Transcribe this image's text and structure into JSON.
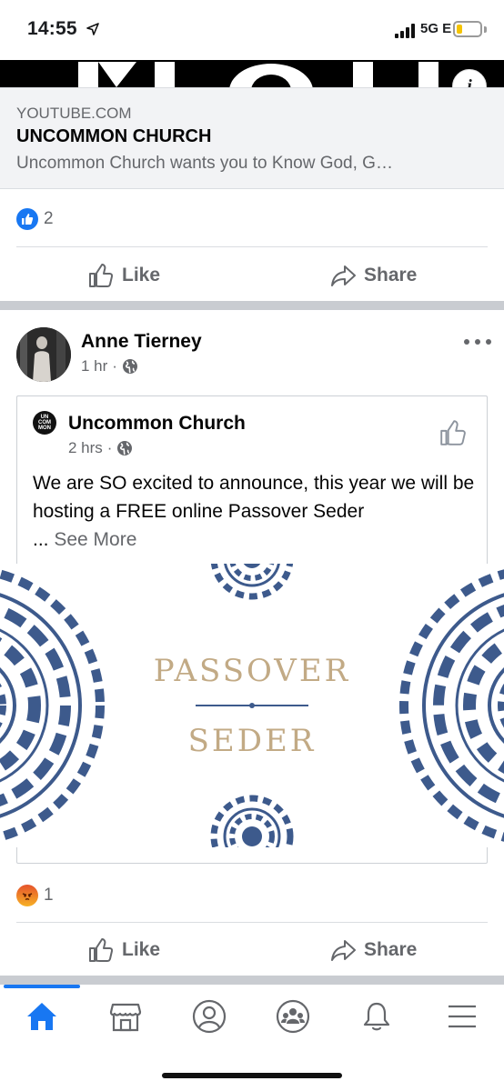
{
  "status_bar": {
    "time": "14:55",
    "network": "5G E",
    "icons": [
      "location-arrow-icon",
      "signal-icon",
      "battery-icon"
    ]
  },
  "link_preview": {
    "domain": "YOUTUBE.COM",
    "title": "UNCOMMON CHURCH",
    "description": "Uncommon Church wants you to Know God, G…",
    "banner_letters": "MON"
  },
  "post1": {
    "reaction_count": "2",
    "like_label": "Like",
    "share_label": "Share"
  },
  "post2": {
    "author": "Anne Tierney",
    "time": "1 hr",
    "dot": "·",
    "shared": {
      "page_name": "Uncommon Church",
      "page_logo_lines": [
        "UN",
        "COM",
        "MON"
      ],
      "time": "2 hrs",
      "dot": "·",
      "text": "We are SO excited to announce, this year we will be hosting a FREE online Passover Seder",
      "ellipsis": "...",
      "see_more": "See More"
    },
    "image": {
      "title": "PASSOVER",
      "subtitle": "SEDER",
      "accent_color": "#c2aa85",
      "pattern_color": "#3d5a8c"
    },
    "reaction_count": "1",
    "like_label": "Like",
    "share_label": "Share"
  },
  "bottom_nav": {
    "active_color": "#1877f2",
    "items": [
      "home-icon",
      "marketplace-icon",
      "profile-icon",
      "groups-icon",
      "notifications-icon",
      "menu-icon"
    ]
  }
}
